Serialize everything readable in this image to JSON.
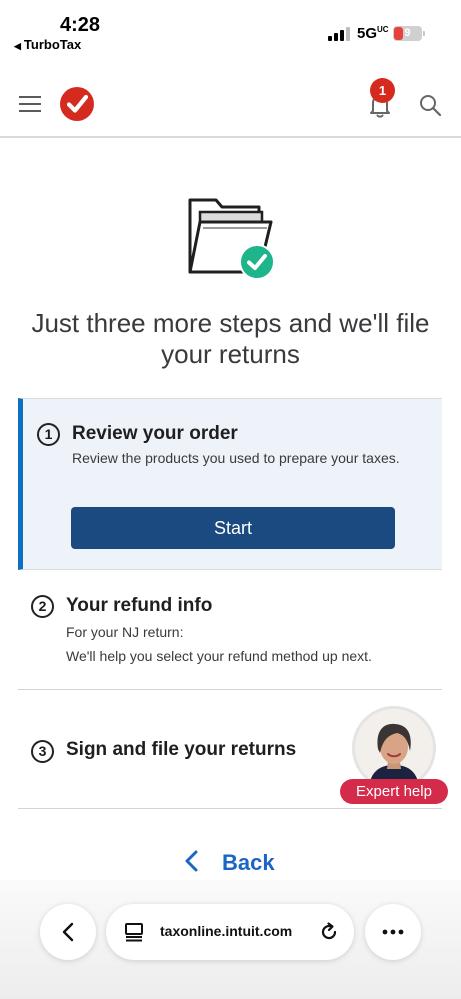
{
  "status_bar": {
    "time": "4:28",
    "back_app": "TurboTax",
    "network": "5G",
    "network_suffix": "UC",
    "battery": "9"
  },
  "header": {
    "notification_count": "1"
  },
  "hero": {
    "headline": "Just three more steps and we'll file your returns"
  },
  "steps": [
    {
      "number": "1",
      "title": "Review your order",
      "description": "Review the products you used to prepare your taxes.",
      "button_label": "Start"
    },
    {
      "number": "2",
      "title": "Your refund info",
      "description_line1": "For your NJ return:",
      "description_line2": "We'll help you select your refund method up next."
    },
    {
      "number": "3",
      "title": "Sign and file your returns"
    }
  ],
  "expert": {
    "label": "Expert help"
  },
  "nav": {
    "back_label": "Back"
  },
  "browser": {
    "url": "taxonline.intuit.com"
  },
  "colors": {
    "brand_red": "#d52b1e",
    "primary_button": "#1b4a80",
    "active_step_bg": "#eef3fa",
    "active_step_border": "#0d6ec4",
    "check_green": "#1eb48c",
    "link_blue": "#1b66c4"
  }
}
